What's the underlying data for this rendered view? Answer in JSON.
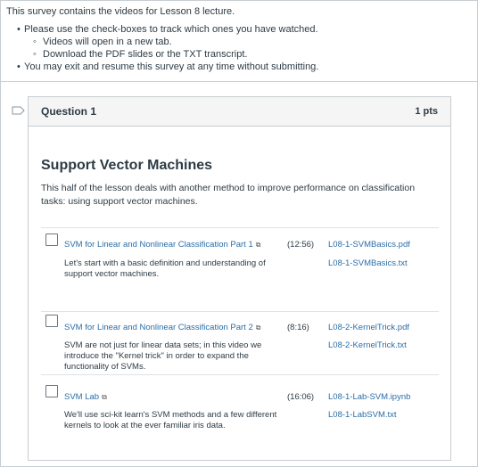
{
  "intro": {
    "line": "This survey contains the videos for Lesson 8 lecture.",
    "bullets": [
      "Please use the check-boxes to track which ones you have watched.",
      "You may exit and resume this survey at any time without submitting."
    ],
    "sub_bullets": [
      "Videos will open in a new tab.",
      "Download the PDF slides or the TXT transcript."
    ]
  },
  "question": {
    "title": "Question 1",
    "points": "1 pts",
    "heading": "Support Vector Machines",
    "description": "This half of the lesson deals with another method to improve performance on classification tasks: using support vector machines."
  },
  "videos": [
    {
      "title": "SVM for Linear and Nonlinear Classification Part 1",
      "duration": "(12:56)",
      "link1": "L08-1-SVMBasics.pdf",
      "link2": "L08-1-SVMBasics.txt",
      "description": "Let's start with a basic definition and understanding of support vector machines."
    },
    {
      "title": "SVM for Linear and Nonlinear Classification Part 2",
      "duration": "(8:16)",
      "link1": "L08-2-KernelTrick.pdf",
      "link2": "L08-2-KernelTrick.txt",
      "description": "SVM are not just for linear data sets; in this video we introduce the \"Kernel trick\" in order to expand the functionality of SVMs."
    },
    {
      "title": "SVM Lab",
      "duration": "(16:06)",
      "link1": "L08-1-Lab-SVM.ipynb",
      "link2": "L08-1-LabSVM.txt",
      "description": "We'll use sci-kit learn's SVM methods and a few different kernels to look at the ever familiar iris data."
    }
  ],
  "icons": {
    "external_link": "external-link-icon",
    "flag": "flag-icon"
  }
}
